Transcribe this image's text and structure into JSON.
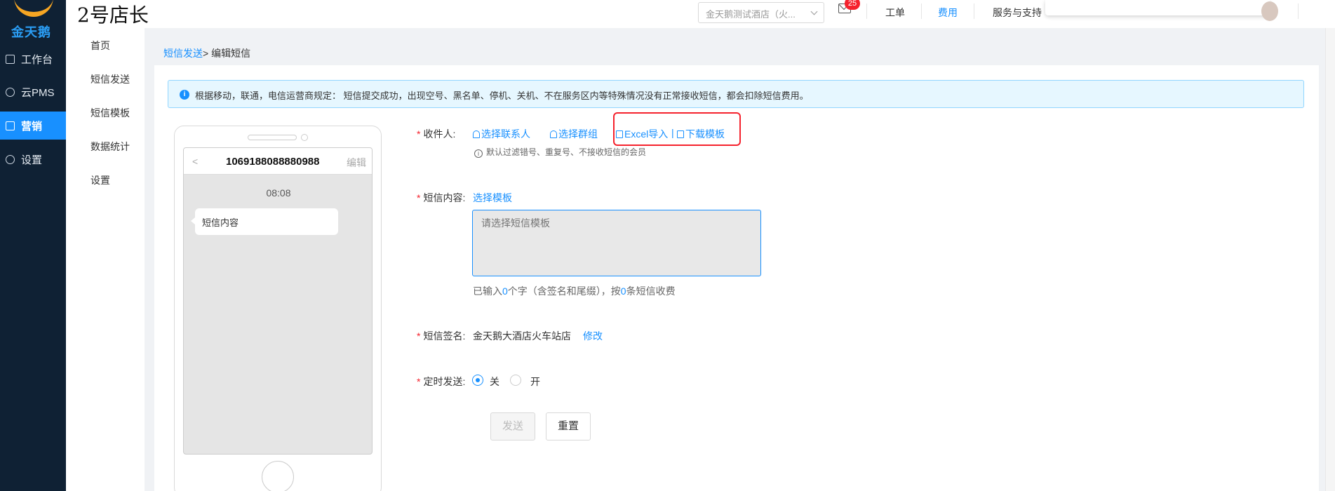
{
  "brand": {
    "logo_text": "金天鹅",
    "app_name": "2号店长"
  },
  "sidebar": {
    "items": [
      {
        "label": "工作台",
        "icon": "workbench-icon"
      },
      {
        "label": "云PMS",
        "icon": "gear-icon"
      },
      {
        "label": "营销",
        "icon": "marketing-icon",
        "active": true
      },
      {
        "label": "设置",
        "icon": "gear-icon"
      }
    ]
  },
  "submenu": {
    "items": [
      "首页",
      "短信发送",
      "短信模板",
      "数据统计",
      "设置"
    ]
  },
  "topbar": {
    "hotel_select": "金天鹅测试酒店（火...",
    "mail_badge": "25",
    "nav": [
      "工单",
      "费用",
      "服务与支持"
    ],
    "active_nav": "费用"
  },
  "breadcrumb": {
    "parent": "短信发送",
    "separator": ">",
    "current": "编辑短信"
  },
  "notice": {
    "text": "根据移动，联通，电信运营商规定：  短信提交成功，出现空号、黑名单、停机、关机、不在服务区内等特殊情况没有正常接收短信，都会扣除短信费用。"
  },
  "phone": {
    "back": "<",
    "number": "1069188088880988",
    "edit": "编辑",
    "time": "08:08",
    "bubble": "短信内容"
  },
  "form": {
    "recipient_label": "收件人:",
    "select_contacts": "选择联系人",
    "select_group": "选择群组",
    "excel_import": "Excel导入",
    "divider": "|",
    "download_template": "下载模板",
    "filter_hint": "默认过滤错号、重复号、不接收短信的会员",
    "content_label": "短信内容:",
    "choose_template": "选择模板",
    "textarea_placeholder": "请选择短信模板",
    "count_prefix": "已输入",
    "count_chars": "0",
    "count_mid": "个字（含签名和尾缀），按",
    "count_msgs": "0",
    "count_suffix": "条短信收费",
    "signature_label": "短信签名:",
    "signature_value": "金天鹅大酒店火车站店",
    "modify": "修改",
    "schedule_label": "定时发送:",
    "schedule_off": "关",
    "schedule_on": "开",
    "schedule_value": "关",
    "send_button": "发送",
    "reset_button": "重置"
  },
  "colors": {
    "primary": "#1890ff",
    "sidebar_bg": "#0f2134",
    "required": "#f5222d",
    "highlight_border": "#f5222d"
  }
}
